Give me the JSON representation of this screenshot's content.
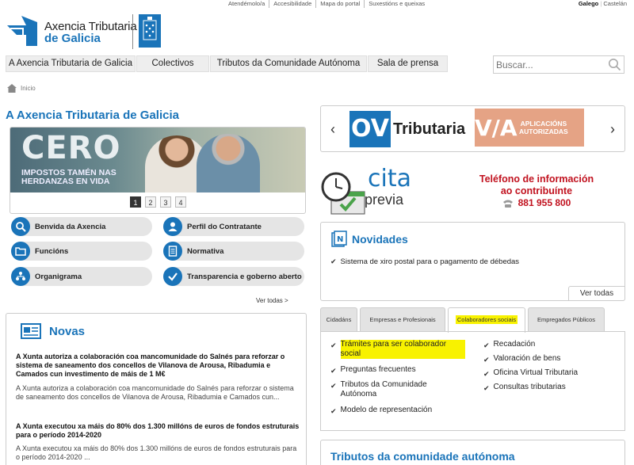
{
  "top_links": [
    "Atendémolo/a",
    "Accesibilidade",
    "Mapa do portal",
    "Suxestións e queixas"
  ],
  "languages": {
    "active": "Galego",
    "other": "Castelán"
  },
  "logo": {
    "line1": "Axencia Tributaria",
    "line2": "de Galicia"
  },
  "nav": [
    "A Axencia Tributaria de Galicia",
    "Colectivos",
    "Tributos da Comunidade Autónoma",
    "Sala de prensa"
  ],
  "search": {
    "placeholder": "Buscar..."
  },
  "breadcrumb": "Inicio",
  "left": {
    "title": "A Axencia Tributaria de Galicia",
    "banner": {
      "big": "CERO",
      "sub_line1": "IMPOSTOS TAMÉN NAS",
      "sub_line2": "HERDANZAS EN VIDA"
    },
    "pager": [
      "1",
      "2",
      "3",
      "4"
    ],
    "quick_links": [
      "Benvida da Axencia",
      "Perfil do Contratante",
      "Funcións",
      "Normativa",
      "Organigrama",
      "Transparencia e goberno aberto"
    ],
    "see_all": "Ver todas >"
  },
  "novas": {
    "title": "Novas",
    "items": [
      {
        "headline": "A Xunta autoriza a colaboración coa mancomunidade do Salnés para reforzar o sistema de saneamento dos concellos de Vilanova de Arousa, Ribadumia e Camados cun investimento de máis de 1 M€",
        "summary": "A Xunta autoriza a colaboración coa mancomunidade do Salnés para reforzar o sistema de saneamento dos concellos de Vilanova de Arousa, Ribadumia e Camados cun..."
      },
      {
        "headline": "A Xunta executou xa máis do 80% dos 1.300 millóns de euros de fondos estruturais para o período 2014-2020",
        "summary": "A Xunta executou xa máis do 80% dos 1.300 millóns de euros de fondos estruturais para o período 2014-2020 ..."
      }
    ]
  },
  "ov": {
    "badge": "OV",
    "text": "Tributaria",
    "via_logo": "V/A",
    "via_line1": "APLICACIÓNS",
    "via_line2": "AUTORIZADAS"
  },
  "cita": {
    "word1": "cita",
    "word2": "previa"
  },
  "phone": {
    "line1": "Teléfono de información",
    "line2": "ao contribuínte",
    "number": "881 955 800"
  },
  "novidades": {
    "title": "Novidades",
    "item": "Sistema de xiro postal para o pagamento de débedas",
    "see_all": "Ver todas"
  },
  "tabs": [
    "Cidadáns",
    "Empresas e Profesionais",
    "Colaboradores sociais",
    "Empregados Públicos"
  ],
  "tab_panel": {
    "left": [
      "Trámites para ser colaborador social",
      "Preguntas frecuentes",
      "Tributos da Comunidade Autónoma",
      "Modelo de representación"
    ],
    "right": [
      "Recadación",
      "Valoración de bens",
      "Oficina Virtual Tributaria",
      "Consultas tributarias"
    ]
  },
  "tributos": {
    "title": "Tributos da comunidade autónoma"
  },
  "colors": {
    "brand_blue": "#1a74b9",
    "highlight": "#f8f200",
    "phone_red": "#c1121f",
    "via_orange": "#e5a385"
  }
}
